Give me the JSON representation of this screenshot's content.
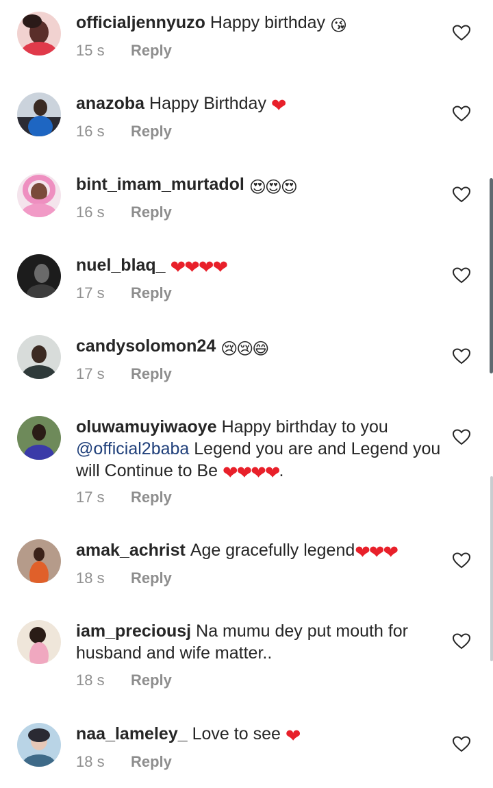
{
  "comments": [
    {
      "user": "officialjennyuzo",
      "text": "Happy birthday",
      "emoji": "😘",
      "time": "15 s",
      "reply": "Reply",
      "avatar_color": "#b3444d"
    },
    {
      "user": "anazoba",
      "text": "Happy Birthday",
      "emoji": "❤",
      "time": "16 s",
      "reply": "Reply",
      "avatar_color": "#1e3a6b"
    },
    {
      "user": "bint_imam_murtadol",
      "text": "",
      "emoji": "😍😍😍",
      "time": "16 s",
      "reply": "Reply",
      "avatar_color": "#e58ab8"
    },
    {
      "user": "nuel_blaq_",
      "text": "",
      "emoji": "❤❤❤❤",
      "time": "17 s",
      "reply": "Reply",
      "avatar_color": "#2b2b2b"
    },
    {
      "user": "candysolomon24",
      "text": "",
      "emoji": "😢😢😄",
      "time": "17 s",
      "reply": "Reply",
      "avatar_color": "#a9b5b8"
    },
    {
      "user": "oluwamuyiwaoye",
      "text_before": "Happy birthday to you",
      "mention": "@official2baba",
      "text_after": " Legend you are and Legend you will Continue to Be",
      "emoji": "❤❤❤❤",
      "text_end": ".",
      "time": "17 s",
      "reply": "Reply",
      "avatar_color": "#3a5a3a"
    },
    {
      "user": "amak_achrist",
      "text": "Age gracefully legend",
      "emoji": "❤❤❤",
      "time": "18 s",
      "reply": "Reply",
      "avatar_color": "#7a5646"
    },
    {
      "user": "iam_preciousj",
      "text": "Na mumu dey put mouth for husband and wife matter..",
      "emoji": "",
      "time": "18 s",
      "reply": "Reply",
      "avatar_color": "#c7a27a"
    },
    {
      "user": "naa_lameley_",
      "text": "Love to see",
      "emoji": "❤",
      "time": "18 s",
      "reply": "Reply",
      "avatar_color": "#3e6a88"
    }
  ],
  "icons": {
    "like": "heart-outline-icon"
  },
  "colors": {
    "username": "#262626",
    "meta": "#8e8e8e",
    "heart": "#e8202a",
    "mention": "#1f3f7a"
  }
}
